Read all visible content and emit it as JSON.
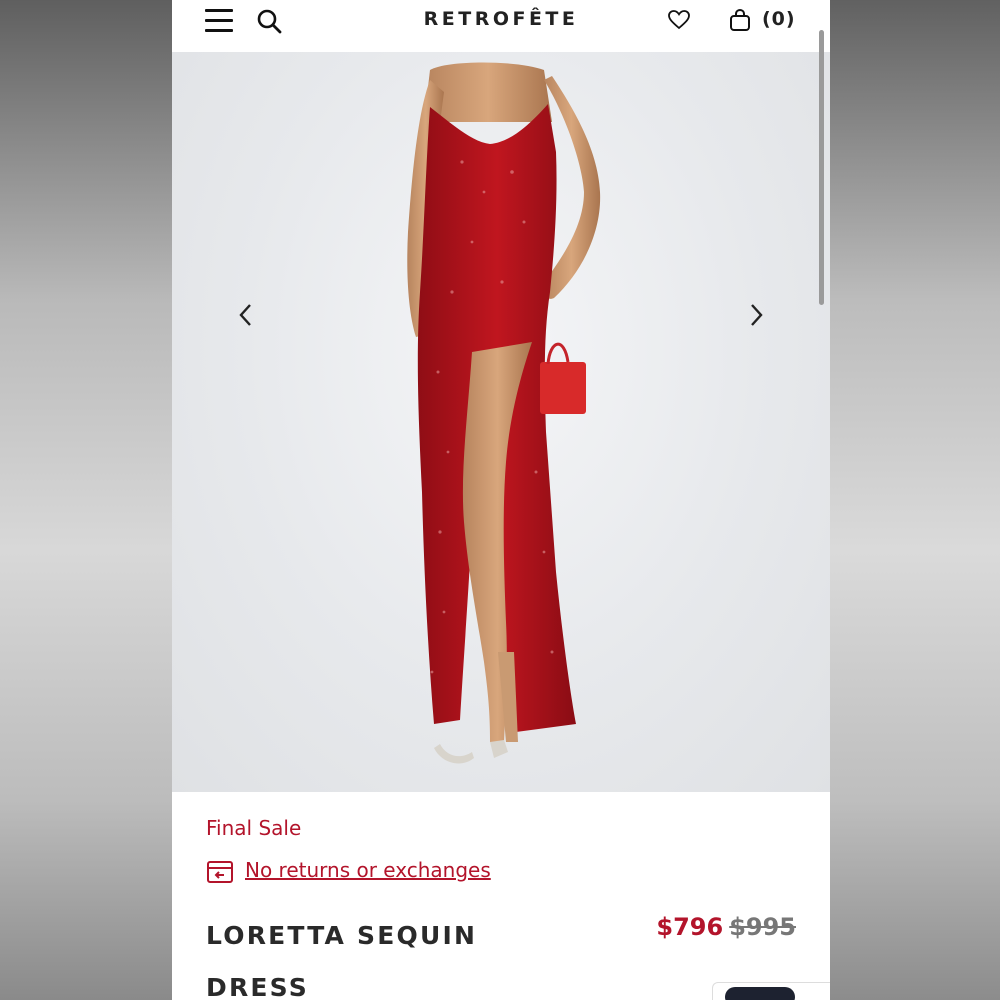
{
  "header": {
    "brand": "RETROFÊTE",
    "cart_count": "(0)"
  },
  "product": {
    "sale_label": "Final Sale",
    "returns_text": "No returns or exchanges",
    "title": "LORETTA SEQUIN DRESS",
    "price_sale": "$796",
    "price_original": "$995"
  },
  "colors": {
    "accent": "#b3142b",
    "dress": "#b5121b"
  },
  "icons": {
    "menu": "hamburger-icon",
    "search": "search-icon",
    "wishlist": "heart-icon",
    "cart": "bag-icon",
    "prev": "chevron-left-icon",
    "next": "chevron-right-icon",
    "returns": "return-box-icon"
  }
}
